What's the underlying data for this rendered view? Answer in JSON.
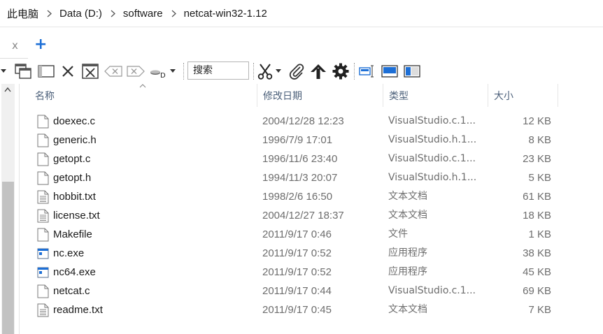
{
  "breadcrumb": {
    "items": [
      "此电脑",
      "Data (D:)",
      "software",
      "netcat-win32-1.12"
    ]
  },
  "tabs": {
    "close_label": "x",
    "add_label": "+"
  },
  "toolbar": {
    "search_placeholder": "搜索",
    "drive_label": "D"
  },
  "columns": {
    "name": "名称",
    "date": "修改日期",
    "type": "类型",
    "size": "大小"
  },
  "files": [
    {
      "name": "doexec.c",
      "date": "2004/12/28 12:23",
      "type": "VisualStudio.c.1...",
      "size": "12 KB",
      "icon": "c-file-icon"
    },
    {
      "name": "generic.h",
      "date": "1996/7/9 17:01",
      "type": "VisualStudio.h.1...",
      "size": "8 KB",
      "icon": "h-file-icon"
    },
    {
      "name": "getopt.c",
      "date": "1996/11/6 23:40",
      "type": "VisualStudio.c.1...",
      "size": "23 KB",
      "icon": "c-file-icon"
    },
    {
      "name": "getopt.h",
      "date": "1994/11/3 20:07",
      "type": "VisualStudio.h.1...",
      "size": "5 KB",
      "icon": "h-file-icon"
    },
    {
      "name": "hobbit.txt",
      "date": "1998/2/6 16:50",
      "type": "文本文档",
      "size": "61 KB",
      "icon": "text-file-icon"
    },
    {
      "name": "license.txt",
      "date": "2004/12/27 18:37",
      "type": "文本文档",
      "size": "18 KB",
      "icon": "text-file-icon"
    },
    {
      "name": "Makefile",
      "date": "2011/9/17 0:46",
      "type": "文件",
      "size": "1 KB",
      "icon": "blank-file-icon"
    },
    {
      "name": "nc.exe",
      "date": "2011/9/17 0:52",
      "type": "应用程序",
      "size": "38 KB",
      "icon": "exe-file-icon"
    },
    {
      "name": "nc64.exe",
      "date": "2011/9/17 0:52",
      "type": "应用程序",
      "size": "45 KB",
      "icon": "exe-file-icon"
    },
    {
      "name": "netcat.c",
      "date": "2011/9/17 0:44",
      "type": "VisualStudio.c.1...",
      "size": "69 KB",
      "icon": "c-file-icon"
    },
    {
      "name": "readme.txt",
      "date": "2011/9/17 0:45",
      "type": "文本文档",
      "size": "7 KB",
      "icon": "text-file-icon"
    }
  ],
  "colors": {
    "accent": "#1d6fd6",
    "header_text": "#4c607a",
    "secondary_text": "#6d6d6d"
  }
}
